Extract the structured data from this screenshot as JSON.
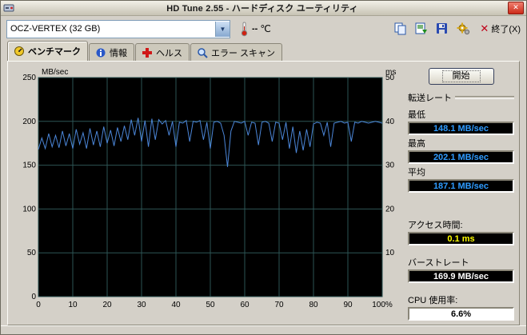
{
  "window": {
    "title": "HD Tune 2.55 - ハードディスク ユーティリティ",
    "close_glyph": "✕"
  },
  "toolbar": {
    "drive_select": "OCZ-VERTEX (32 GB)",
    "temp_value": "--",
    "temp_unit": "℃",
    "exit_label": "終了(X)"
  },
  "tabs": [
    {
      "label": "ベンチマーク"
    },
    {
      "label": "情報"
    },
    {
      "label": "ヘルス"
    },
    {
      "label": "エラー スキャン"
    }
  ],
  "side": {
    "start_button": "開始",
    "group_transfer": "転送レート",
    "min_label": "最低",
    "min_value": "148.1 MB/sec",
    "max_label": "最高",
    "max_value": "202.1 MB/sec",
    "avg_label": "平均",
    "avg_value": "187.1 MB/sec",
    "access_label": "アクセス時間:",
    "access_value": "0.1 ms",
    "burst_label": "バーストレート",
    "burst_value": "169.9 MB/sec",
    "cpu_label": "CPU 使用率:",
    "cpu_value": "6.6%"
  },
  "colors": {
    "value_blue": "#2e9bff",
    "value_yellow": "#ffff00",
    "value_white": "#ffffff",
    "cpu_text": "#000000"
  },
  "chart_data": {
    "type": "line",
    "title": "",
    "xlabel": "%",
    "ylabel_left": "MB/sec",
    "ylabel_right": "ms",
    "x_tick_labels": [
      "0",
      "10",
      "20",
      "30",
      "40",
      "50",
      "60",
      "70",
      "80",
      "90",
      "100%"
    ],
    "y_left_ticks": [
      250,
      200,
      150,
      100,
      50,
      0
    ],
    "y_right_ticks": [
      50,
      40,
      30,
      20,
      10
    ],
    "ylim_left": [
      0,
      250
    ],
    "ylim_right": [
      0,
      50
    ],
    "grid": true,
    "legend": "none",
    "colors": {
      "bg": "#000000",
      "grid": "#2d5555",
      "line": "#4b86d8",
      "axis_text": "#000000"
    },
    "series": [
      {
        "name": "transfer_rate_MB_per_sec",
        "x": [
          0,
          1,
          2,
          3,
          4,
          5,
          6,
          7,
          8,
          9,
          10,
          11,
          12,
          13,
          14,
          15,
          16,
          17,
          18,
          19,
          20,
          21,
          22,
          23,
          24,
          25,
          26,
          27,
          28,
          29,
          30,
          31,
          32,
          33,
          34,
          35,
          36,
          37,
          38,
          39,
          40,
          41,
          42,
          43,
          44,
          45,
          46,
          47,
          48,
          49,
          50,
          51,
          52,
          53,
          54,
          55,
          56,
          57,
          58,
          59,
          60,
          61,
          62,
          63,
          64,
          65,
          66,
          67,
          68,
          69,
          70,
          71,
          72,
          73,
          74,
          75,
          76,
          77,
          78,
          79,
          80,
          81,
          82,
          83,
          84,
          85,
          86,
          87,
          88,
          89,
          90,
          91,
          92,
          93,
          94,
          95,
          96,
          97,
          98,
          99,
          100
        ],
        "y": [
          168,
          181,
          169,
          186,
          171,
          184,
          170,
          189,
          172,
          186,
          169,
          191,
          174,
          187,
          169,
          192,
          173,
          189,
          171,
          194,
          175,
          190,
          172,
          193,
          177,
          195,
          179,
          202,
          184,
          204,
          177,
          201,
          171,
          203,
          179,
          202,
          197,
          201,
          184,
          200,
          171,
          199,
          198,
          201,
          177,
          200,
          199,
          201,
          179,
          199,
          169,
          199,
          200,
          198,
          184,
          148,
          189,
          200,
          199,
          198,
          200,
          184,
          199,
          198,
          173,
          199,
          200,
          198,
          177,
          199,
          198,
          179,
          199,
          169,
          194,
          164,
          189,
          167,
          191,
          171,
          197,
          199,
          198,
          184,
          199,
          171,
          198,
          199,
          200,
          198,
          199,
          177,
          199,
          198,
          200,
          199,
          198,
          199,
          200,
          199,
          198
        ]
      }
    ],
    "summary": {
      "min": 148.1,
      "max": 202.1,
      "avg": 187.1,
      "access_time_ms": 0.1,
      "burst_rate": 169.9,
      "cpu_usage_pct": 6.6
    }
  }
}
